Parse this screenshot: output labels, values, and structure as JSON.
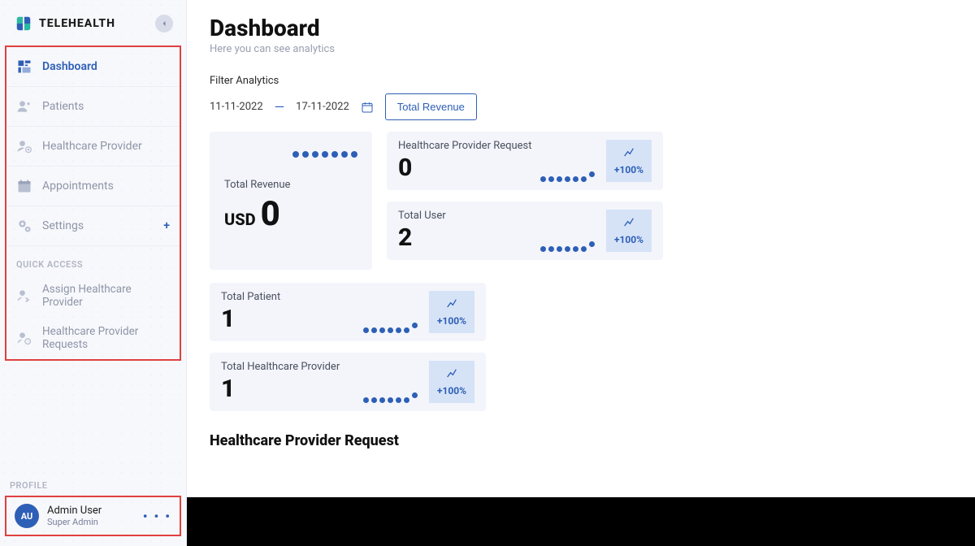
{
  "brand": {
    "name": "TELEHEALTH"
  },
  "sidebar": {
    "items": [
      {
        "label": "Dashboard",
        "icon": "grid"
      },
      {
        "label": "Patients",
        "icon": "user-plus"
      },
      {
        "label": "Healthcare Provider",
        "icon": "user-gear"
      },
      {
        "label": "Appointments",
        "icon": "calendar-check"
      },
      {
        "label": "Settings",
        "icon": "gears",
        "plus": "+"
      }
    ],
    "quick_access_label": "QUICK ACCESS",
    "quick_access": [
      {
        "label": "Assign Healthcare Provider"
      },
      {
        "label": "Healthcare Provider Requests"
      }
    ],
    "profile_label": "PROFILE",
    "profile": {
      "initials": "AU",
      "name": "Admin User",
      "role": "Super Admin"
    }
  },
  "page": {
    "title": "Dashboard",
    "subtitle": "Here you can see analytics",
    "filter_label": "Filter Analytics",
    "date_from": "11-11-2022",
    "date_dash": "—",
    "date_to": "17-11-2022",
    "revenue_button": "Total Revenue"
  },
  "metrics": {
    "total_revenue": {
      "label": "Total Revenue",
      "currency": "USD",
      "value": "0"
    },
    "provider_request": {
      "label": "Healthcare Provider Request",
      "value": "0",
      "trend": "+100%"
    },
    "total_user": {
      "label": "Total User",
      "value": "2",
      "trend": "+100%"
    },
    "total_patient": {
      "label": "Total Patient",
      "value": "1",
      "trend": "+100%"
    },
    "total_provider": {
      "label": "Total Healthcare Provider",
      "value": "1",
      "trend": "+100%"
    }
  },
  "section": {
    "provider_request_title": "Healthcare Provider Request"
  }
}
